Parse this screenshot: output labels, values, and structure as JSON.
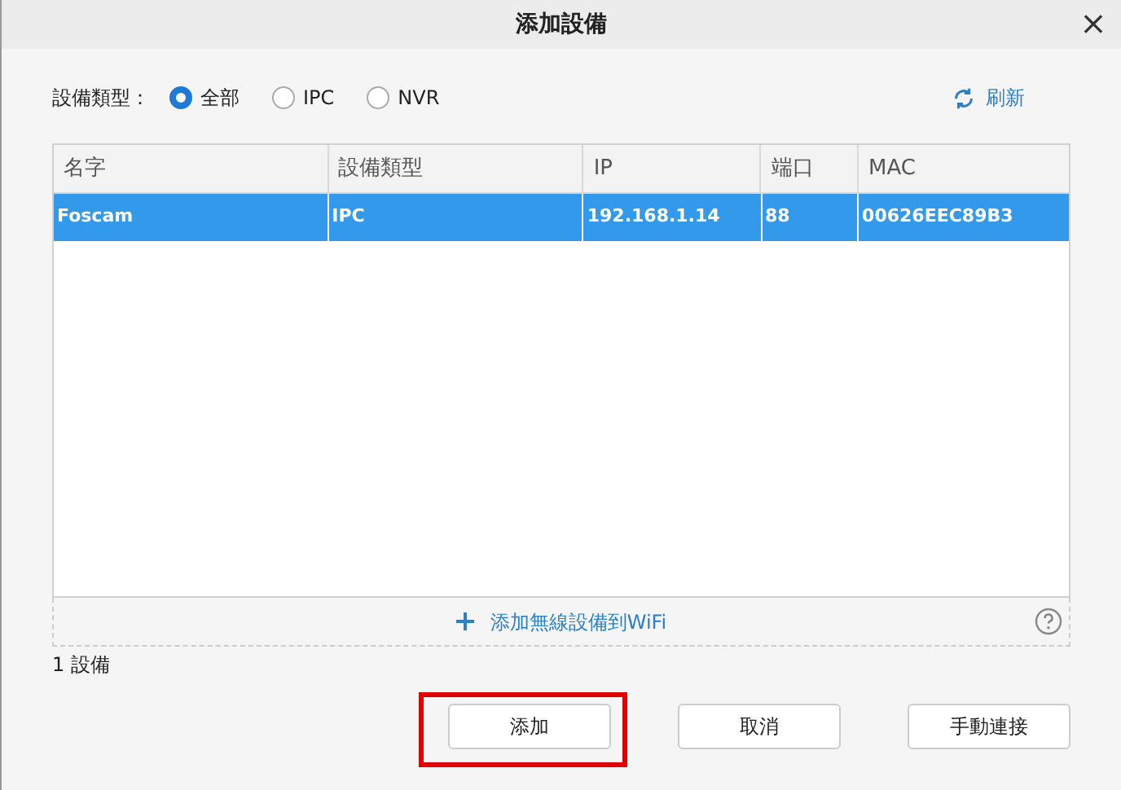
{
  "window": {
    "title": "添加設備",
    "close": "×"
  },
  "filter": {
    "label": "設備類型：",
    "options": [
      {
        "label": "全部",
        "selected": true
      },
      {
        "label": "IPC",
        "selected": false
      },
      {
        "label": "NVR",
        "selected": false
      }
    ]
  },
  "refresh": "刷新",
  "table": {
    "columns": [
      "名字",
      "設備類型",
      "IP",
      "端口",
      "MAC"
    ],
    "rows": [
      {
        "cells": [
          "Foscam",
          "IPC",
          "192.168.1.14",
          "88",
          "00626EEC89B3"
        ],
        "selected": true
      }
    ]
  },
  "wifi_link": "添加無線設備到WiFi",
  "count": "1 設備",
  "buttons": [
    {
      "label": "添加",
      "highlighted": true
    },
    {
      "label": "取消",
      "highlighted": false
    },
    {
      "label": "手動連接",
      "highlighted": false
    }
  ]
}
